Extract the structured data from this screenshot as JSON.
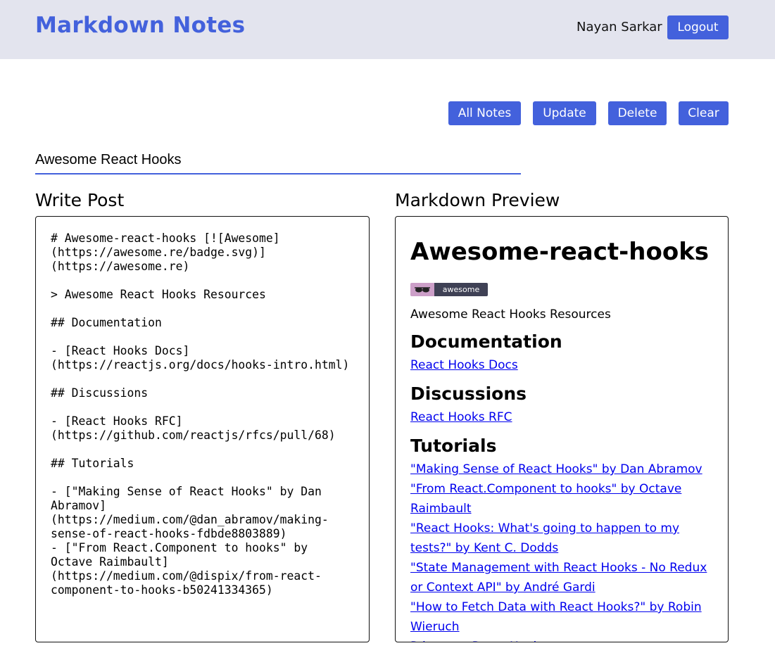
{
  "header": {
    "brand": "Markdown Notes",
    "user_name": "Nayan Sarkar",
    "logout_label": "Logout"
  },
  "toolbar": {
    "all_notes_label": "All Notes",
    "update_label": "Update",
    "delete_label": "Delete",
    "clear_label": "Clear"
  },
  "note": {
    "title_value": "Awesome React Hooks",
    "write_heading": "Write Post",
    "preview_heading": "Markdown Preview",
    "markdown_source": "# Awesome-react-hooks [![Awesome](https://awesome.re/badge.svg)](https://awesome.re)\n\n> Awesome React Hooks Resources\n\n## Documentation\n\n- [React Hooks Docs](https://reactjs.org/docs/hooks-intro.html)\n\n## Discussions\n\n- [React Hooks RFC](https://github.com/reactjs/rfcs/pull/68)\n\n## Tutorials\n\n- [\"Making Sense of React Hooks\" by Dan Abramov](https://medium.com/@dan_abramov/making-sense-of-react-hooks-fdbde8803889)\n- [\"From React.Component to hooks\" by Octave Raimbault](https://medium.com/@dispix/from-react-component-to-hooks-b50241334365)"
  },
  "preview": {
    "h1": "Awesome-react-hooks",
    "badge_text": "awesome",
    "badge_icon": "sunglasses-icon",
    "blockquote": "Awesome React Hooks Resources",
    "h2_documentation": "Documentation",
    "link_docs": "React Hooks Docs",
    "h2_discussions": "Discussions",
    "link_rfc": "React Hooks RFC",
    "h2_tutorials": "Tutorials",
    "tutorial_links": [
      "\"Making Sense of React Hooks\" by Dan Abramov",
      "\"From React.Component to hooks\" by Octave Raimbault",
      "\"React Hooks: What's going to happen to my tests?\" by Kent C. Dodds",
      "\"State Management with React Hooks - No Redux or Context API\" by André Gardi",
      "\"How to Fetch Data with React Hooks?\" by Robin Wieruch",
      "Primer on React Hooks"
    ]
  },
  "colors": {
    "accent": "#4361dc",
    "header_bg": "#e3e4ee",
    "link": "#0000ee"
  }
}
